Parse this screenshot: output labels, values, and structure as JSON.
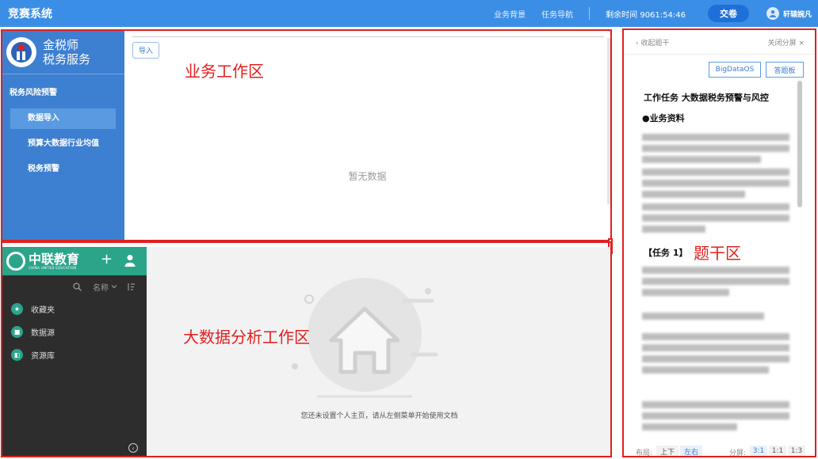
{
  "header": {
    "app_title": "竞赛系统",
    "nav": [
      "业务背景",
      "任务导航"
    ],
    "timer": "剩余时间 9061:54:46",
    "submit_label": "交卷",
    "user_name": "轩辕婉凡"
  },
  "annotations": {
    "business_area": "业务工作区",
    "bigdata_area": "大数据分析工作区",
    "question_area": "题干区"
  },
  "tax_app": {
    "logo_line1": "金税师",
    "logo_line2": "税务服务",
    "menu_heading": "税务风险预警",
    "menu_items": [
      "数据导入",
      "预算大数据行业均值",
      "税务预警"
    ],
    "active_index": 0,
    "import_label": "导入",
    "empty_text": "暂无数据"
  },
  "bigdata_app": {
    "logo_main": "中联教育",
    "logo_sub": "CHINA UNITED EDUCATION",
    "sort_label": "名称",
    "nav_items": [
      "收藏夹",
      "数据源",
      "资源库"
    ],
    "empty_note": "您还未设置个人主页，请从左侧菜单开始使用文档"
  },
  "question_panel": {
    "expand_label": "收起题干",
    "close_label": "关闭分屏",
    "buttons": [
      "BigDataOS",
      "答题板"
    ],
    "task_title": "工作任务 大数据税务预警与风控",
    "section_title": "●业务资料",
    "task_label": "【任务 1】",
    "layout_label": "布局:",
    "layout_options": [
      "上下",
      "左右"
    ],
    "split_label": "分屏:",
    "split_options": [
      "3:1",
      "1:1",
      "1:3"
    ]
  },
  "colors": {
    "header_bg": "#3a8ee6",
    "annotation_red": "#e02020",
    "tax_sidebar": "#3d7fd0",
    "bigdata_green": "#2aa58a"
  }
}
